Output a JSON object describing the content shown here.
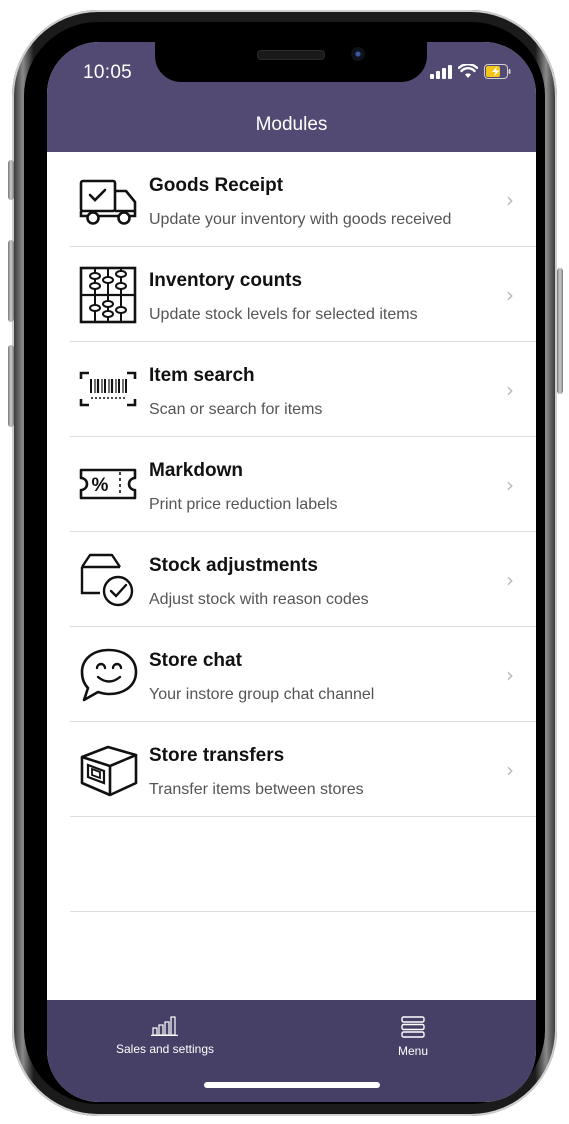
{
  "status_bar": {
    "time": "10:05"
  },
  "header": {
    "title": "Modules"
  },
  "modules": [
    {
      "icon": "delivery-truck-icon",
      "title": "Goods Receipt",
      "subtitle": "Update your inventory with goods received"
    },
    {
      "icon": "abacus-icon",
      "title": "Inventory counts",
      "subtitle": "Update stock levels for selected items"
    },
    {
      "icon": "barcode-scan-icon",
      "title": "Item search",
      "subtitle": "Scan or search for items"
    },
    {
      "icon": "percent-ticket-icon",
      "title": "Markdown",
      "subtitle": "Print price reduction labels"
    },
    {
      "icon": "box-check-icon",
      "title": "Stock adjustments",
      "subtitle": "Adjust stock with reason codes"
    },
    {
      "icon": "smiley-chat-icon",
      "title": "Store chat",
      "subtitle": "Your instore group chat channel"
    },
    {
      "icon": "package-box-icon",
      "title": "Store transfers",
      "subtitle": "Transfer items between stores"
    }
  ],
  "tabbar": {
    "left": {
      "icon": "bar-chart-icon",
      "label": "Sales and settings"
    },
    "right": {
      "icon": "menu-icon",
      "label": "Menu"
    }
  },
  "colors": {
    "header": "#524a72",
    "tabbar": "#463f66",
    "battery": "#f5c518"
  }
}
